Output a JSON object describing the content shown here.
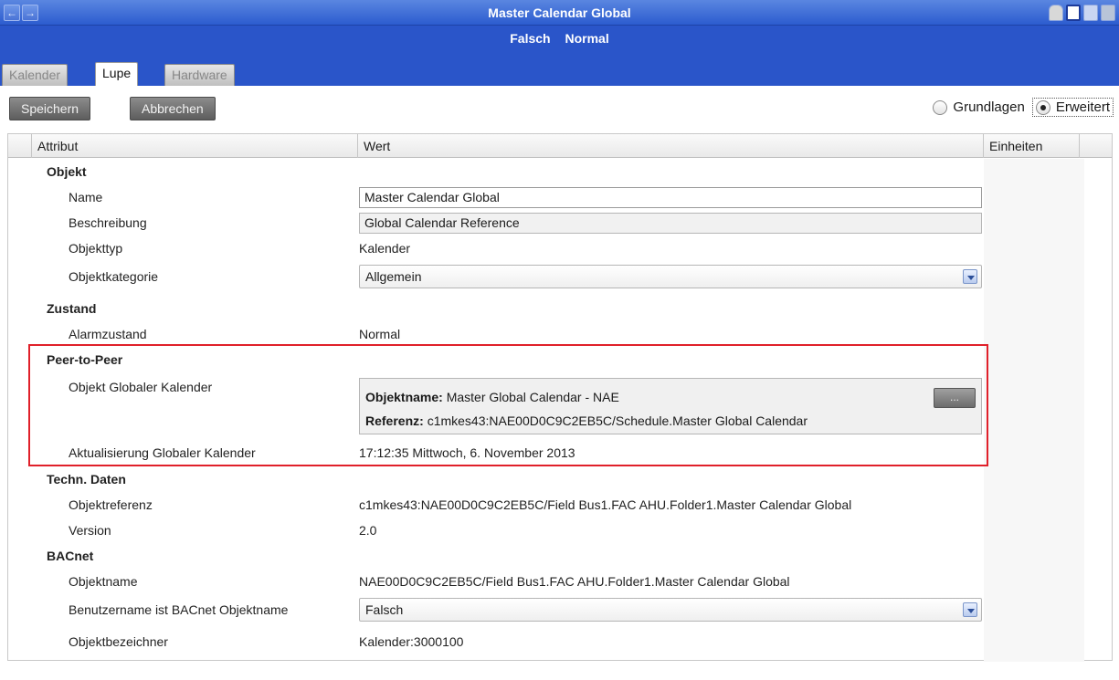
{
  "window": {
    "title": "Master Calendar Global",
    "back_icon": "back-arrow-icon",
    "forward_icon": "forward-arrow-icon"
  },
  "status": [
    "Falsch",
    "Normal"
  ],
  "tabs": [
    {
      "label": "Kalender",
      "active": false
    },
    {
      "label": "Lupe",
      "active": true
    },
    {
      "label": "Hardware",
      "active": false
    }
  ],
  "toolbar": {
    "save_label": "Speichern",
    "cancel_label": "Abbrechen",
    "radio_basic": "Grundlagen",
    "radio_advanced": "Erweitert",
    "selected_mode": "Erweitert"
  },
  "columns": {
    "attribute": "Attribut",
    "value": "Wert",
    "units": "Einheiten"
  },
  "rows": {
    "objekt": "Objekt",
    "name_label": "Name",
    "name_value": "Master Calendar Global",
    "beschreibung_label": "Beschreibung",
    "beschreibung_value": "Global Calendar Reference",
    "objekttyp_label": "Objekttyp",
    "objekttyp_value": "Kalender",
    "objektkategorie_label": "Objektkategorie",
    "objektkategorie_value": "Allgemein",
    "zustand": "Zustand",
    "alarmzustand_label": "Alarmzustand",
    "alarmzustand_value": "Normal",
    "peer": "Peer-to-Peer",
    "globcal_label": "Objekt Globaler Kalender",
    "globcal_objname_key": "Objektname:",
    "globcal_objname_val": "Master Global Calendar - NAE",
    "globcal_ref_key": "Referenz:",
    "globcal_ref_val": "c1mkes43:NAE00D0C9C2EB5C/Schedule.Master Global Calendar",
    "globcal_button": "...",
    "update_label": "Aktualisierung Globaler Kalender",
    "update_value": "17:12:35  Mittwoch, 6. November 2013",
    "techn": "Techn. Daten",
    "objektreferenz_label": "Objektreferenz",
    "objektreferenz_value": "c1mkes43:NAE00D0C9C2EB5C/Field Bus1.FAC AHU.Folder1.Master Calendar Global",
    "version_label": "Version",
    "version_value": "2.0",
    "bacnet": "BACnet",
    "objektname_label": "Objektname",
    "objektname_value": "NAE00D0C9C2EB5C/Field Bus1.FAC AHU.Folder1.Master Calendar Global",
    "benutzer_label": "Benutzername ist BACnet Objektname",
    "benutzer_value": "Falsch",
    "objektbezeichner_label": "Objektbezeichner",
    "objektbezeichner_value": "Kalender:3000100"
  },
  "colors": {
    "title_bar": "#2c5ccf",
    "status_band": "#2a55c9",
    "highlight": "#e0202a"
  }
}
